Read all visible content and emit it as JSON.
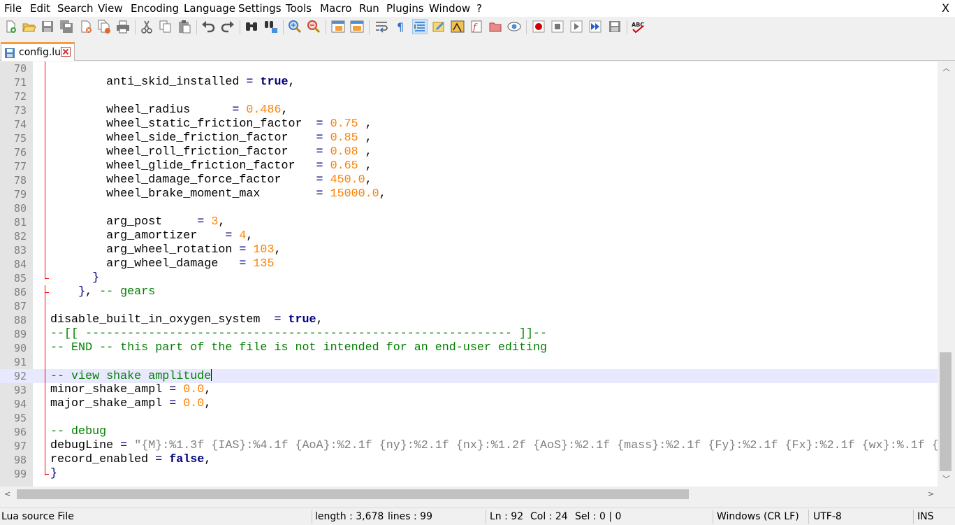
{
  "menu": {
    "items": [
      "File",
      "Edit",
      "Search",
      "View",
      "Encoding",
      "Language",
      "Settings",
      "Tools",
      "Macro",
      "Run",
      "Plugins",
      "Window",
      "?"
    ],
    "close_label": "X"
  },
  "toolbar": {
    "icons": [
      "new-file-icon",
      "open-file-icon",
      "save-icon",
      "save-all-icon",
      "close-icon",
      "close-all-icon",
      "print-icon",
      "cut-icon",
      "copy-icon",
      "paste-icon",
      "undo-icon",
      "redo-icon",
      "find-icon",
      "replace-icon",
      "zoom-in-icon",
      "zoom-out-icon",
      "sync-vertical-icon",
      "sync-horizontal-icon",
      "word-wrap-icon",
      "show-all-characters-icon",
      "indent-guide-icon",
      "user-defined-language-icon",
      "document-map-icon",
      "function-list-icon",
      "folder-as-workspace-icon",
      "monitoring-icon",
      "record-macro-icon",
      "stop-macro-icon",
      "play-macro-icon",
      "run-macro-multiple-icon",
      "save-macro-icon",
      "spell-check-icon"
    ],
    "spell_check_label": "ABC"
  },
  "tab": {
    "label": "config.lua"
  },
  "editor": {
    "lines": [
      {
        "n": "70",
        "code": ""
      },
      {
        "n": "71",
        "code": "        anti_skid_installed = true,"
      },
      {
        "n": "72",
        "code": ""
      },
      {
        "n": "73",
        "code": "        wheel_radius      = 0.486,"
      },
      {
        "n": "74",
        "code": "        wheel_static_friction_factor  = 0.75 ,"
      },
      {
        "n": "75",
        "code": "        wheel_side_friction_factor    = 0.85 ,"
      },
      {
        "n": "76",
        "code": "        wheel_roll_friction_factor    = 0.08 ,"
      },
      {
        "n": "77",
        "code": "        wheel_glide_friction_factor   = 0.65 ,"
      },
      {
        "n": "78",
        "code": "        wheel_damage_force_factor     = 450.0,"
      },
      {
        "n": "79",
        "code": "        wheel_brake_moment_max        = 15000.0,"
      },
      {
        "n": "80",
        "code": ""
      },
      {
        "n": "81",
        "code": "        arg_post     = 3,"
      },
      {
        "n": "82",
        "code": "        arg_amortizer    = 4,"
      },
      {
        "n": "83",
        "code": "        arg_wheel_rotation = 103,"
      },
      {
        "n": "84",
        "code": "        arg_wheel_damage   = 135"
      },
      {
        "n": "85",
        "code": "      }"
      },
      {
        "n": "86",
        "code": "    }, -- gears"
      },
      {
        "n": "87",
        "code": ""
      },
      {
        "n": "88",
        "code": "disable_built_in_oxygen_system  = true,"
      },
      {
        "n": "89",
        "code": "--[[ ------------------------------------------------------------- ]]--"
      },
      {
        "n": "90",
        "code": "-- END -- this part of the file is not intended for an end-user editing"
      },
      {
        "n": "91",
        "code": ""
      },
      {
        "n": "92",
        "code": "-- view shake amplitude"
      },
      {
        "n": "93",
        "code": "minor_shake_ampl = 0.0,"
      },
      {
        "n": "94",
        "code": "major_shake_ampl = 0.0,"
      },
      {
        "n": "95",
        "code": ""
      },
      {
        "n": "96",
        "code": "-- debug"
      },
      {
        "n": "97",
        "code": "debugLine = \"{M}:%1.3f {IAS}:%4.1f {AoA}:%2.1f {ny}:%2.1f {nx}:%1.2f {AoS}:%2.1f {mass}:%2.1f {Fy}:%2.1f {Fx}:%2.1f {wx}:%.1f {"
      },
      {
        "n": "98",
        "code": "record_enabled = false,"
      },
      {
        "n": "99",
        "code": "}"
      }
    ],
    "current_line": "92"
  },
  "status": {
    "file_type": "Lua source File",
    "length": "length : 3,678",
    "lines": "lines : 99",
    "ln": "Ln : 92",
    "col": "Col : 24",
    "sel": "Sel : 0 | 0",
    "eol": "Windows (CR LF)",
    "encoding": "UTF-8",
    "mode": "INS"
  },
  "colors": {
    "keyword": "#00007f",
    "number": "#ff8000",
    "comment": "#008000",
    "string": "#808080",
    "tab_accent": "#fa9b3c",
    "fold_margin": "#ff0000",
    "current_line": "#e8e8ff"
  }
}
